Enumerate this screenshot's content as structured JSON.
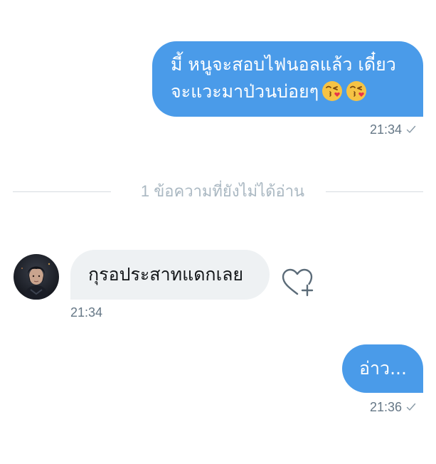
{
  "conversation": {
    "messages": [
      {
        "direction": "outgoing",
        "lines": [
          "มี้ หนูจะสอบไฟนอลแล้ว เดี๋ยว",
          "จะแวะมาป่วนบ่อยๆ"
        ],
        "emojis": [
          "kissing-face-with-heart-emoji",
          "kissing-face-with-heart-emoji"
        ],
        "time": "21:34",
        "status_icon": "sent-check-icon"
      },
      {
        "direction": "incoming",
        "text": "กุรอประสาทแดกเลย",
        "time": "21:34",
        "reaction_icon": "heart-add-icon"
      },
      {
        "direction": "outgoing",
        "text": "อ่าว...",
        "time": "21:36",
        "status_icon": "sent-check-icon"
      }
    ],
    "unread_divider": "1 ข้อความที่ยังไม่ได้อ่าน"
  },
  "colors": {
    "outgoing_bubble": "#4a9be9",
    "incoming_bubble": "#eef1f3",
    "meta_text": "#657786",
    "divider_text": "#aab8c2",
    "divider_line": "#d6dbe0"
  }
}
